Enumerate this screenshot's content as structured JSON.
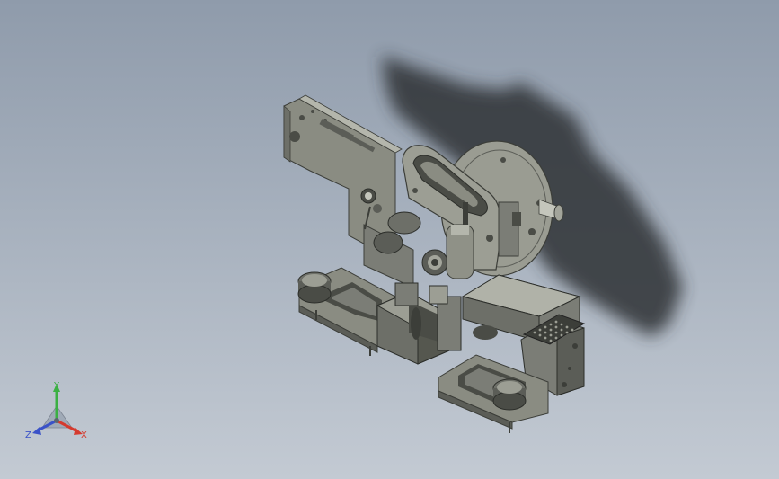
{
  "viewport": {
    "background_top": "#8f9bab",
    "background_bottom": "#c3cad3"
  },
  "model": {
    "body_color": "#8a8c82",
    "dark_color": "#4a4c46",
    "light_color": "#b4b6ac",
    "shadow_color": "#2e3034"
  },
  "triad": {
    "x_label": "X",
    "y_label": "Y",
    "z_label": "Z",
    "x_color": "#d43b2f",
    "y_color": "#3bb043",
    "z_color": "#3a52c8"
  }
}
